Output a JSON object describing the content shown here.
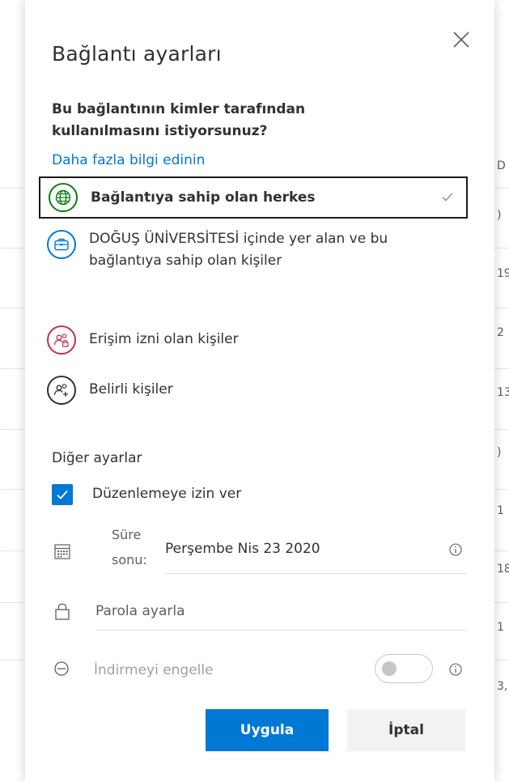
{
  "background": {
    "row_chars": [
      "D",
      ")",
      "19",
      "2",
      "13",
      ")",
      "1",
      "18",
      "1",
      "3,"
    ]
  },
  "panel": {
    "title": "Bağlantı ayarları",
    "question": "Bu bağlantının kimler tarafından kullanılmasını istiyorsunuz?",
    "learn_more": "Daha fazla bilgi edinin",
    "options": [
      {
        "label": "Bağlantıya sahip olan herkes",
        "icon": "globe-icon",
        "selected": true
      },
      {
        "label": "DOĞUŞ ÜNİVERSİTESİ içinde yer alan ve bu bağlantıya sahip olan kişiler",
        "icon": "organization-icon",
        "selected": false
      },
      {
        "label": "Erişim izni olan kişiler",
        "icon": "people-lock-icon",
        "selected": false
      },
      {
        "label": "Belirli kişiler",
        "icon": "people-add-icon",
        "selected": false
      }
    ],
    "other_settings": {
      "title": "Diğer ayarlar",
      "allow_editing": {
        "label": "Düzenlemeye izin ver",
        "checked": true
      },
      "expiration": {
        "label_line1": "Süre",
        "label_line2": "sonu:",
        "value": "Perşembe Nis 23 2020"
      },
      "password": {
        "placeholder": "Parola ayarla"
      },
      "block_download": {
        "label": "İndirmeyi engelle",
        "enabled": false
      }
    },
    "buttons": {
      "apply": "Uygula",
      "cancel": "İptal"
    }
  },
  "colors": {
    "accent": "#0078d4",
    "globe": "#107c10",
    "organization": "#0078d4",
    "people_lock": "#c4314b",
    "people_add": "#323130"
  }
}
